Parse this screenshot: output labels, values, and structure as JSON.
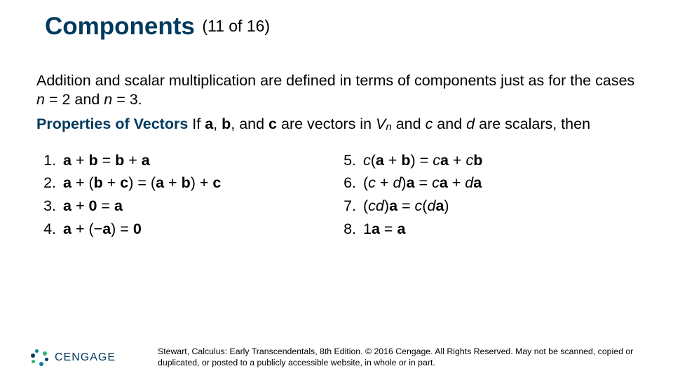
{
  "title": {
    "main": "Components",
    "count": "(11 of 16)"
  },
  "intro": "Addition and scalar multiplication are defined in terms of components just as for the cases n = 2 and n = 3.",
  "properties_lead": "Properties of Vectors",
  "properties_rest": "If a, b, and c are vectors in Vn and c and d are scalars, then",
  "props_left": [
    {
      "num": "1.",
      "html": "<span class='b'>a</span> + <span class='b'>b</span> = <span class='b'>b</span> + <span class='b'>a</span>"
    },
    {
      "num": "2.",
      "html": "<span class='b'>a</span> + (<span class='b'>b</span> + <span class='b'>c</span>) = (<span class='b'>a</span> + <span class='b'>b</span>) + <span class='b'>c</span>"
    },
    {
      "num": "3.",
      "html": "<span class='b'>a</span> + <span class='b'>0</span> = <span class='b'>a</span>"
    },
    {
      "num": "4.",
      "html": "<span class='b'>a</span> + (−<span class='b'>a</span>) = <span class='b'>0</span>"
    }
  ],
  "props_right": [
    {
      "num": "5.",
      "html": "<span class='it'>c</span>(<span class='b'>a</span> + <span class='b'>b</span>) = <span class='it'>c</span><span class='b'>a</span> + <span class='it'>c</span><span class='b'>b</span>"
    },
    {
      "num": "6.",
      "html": "(<span class='it'>c</span> + <span class='it'>d</span>)<span class='b'>a</span> = <span class='it'>c</span><span class='b'>a</span> + <span class='it'>d</span><span class='b'>a</span>"
    },
    {
      "num": "7.",
      "html": "(<span class='it'>cd</span>)<span class='b'>a</span> = <span class='it'>c</span>(<span class='it'>d</span><span class='b'>a</span>)"
    },
    {
      "num": "8.",
      "html": "1<span class='b'>a</span> = <span class='b'>a</span>"
    }
  ],
  "logo_text": "CENGAGE",
  "copyright": "Stewart, Calculus: Early Transcendentals, 8th Edition. © 2016 Cengage. All Rights Reserved. May not be scanned, copied or duplicated, or posted to a publicly accessible website, in whole or in part."
}
